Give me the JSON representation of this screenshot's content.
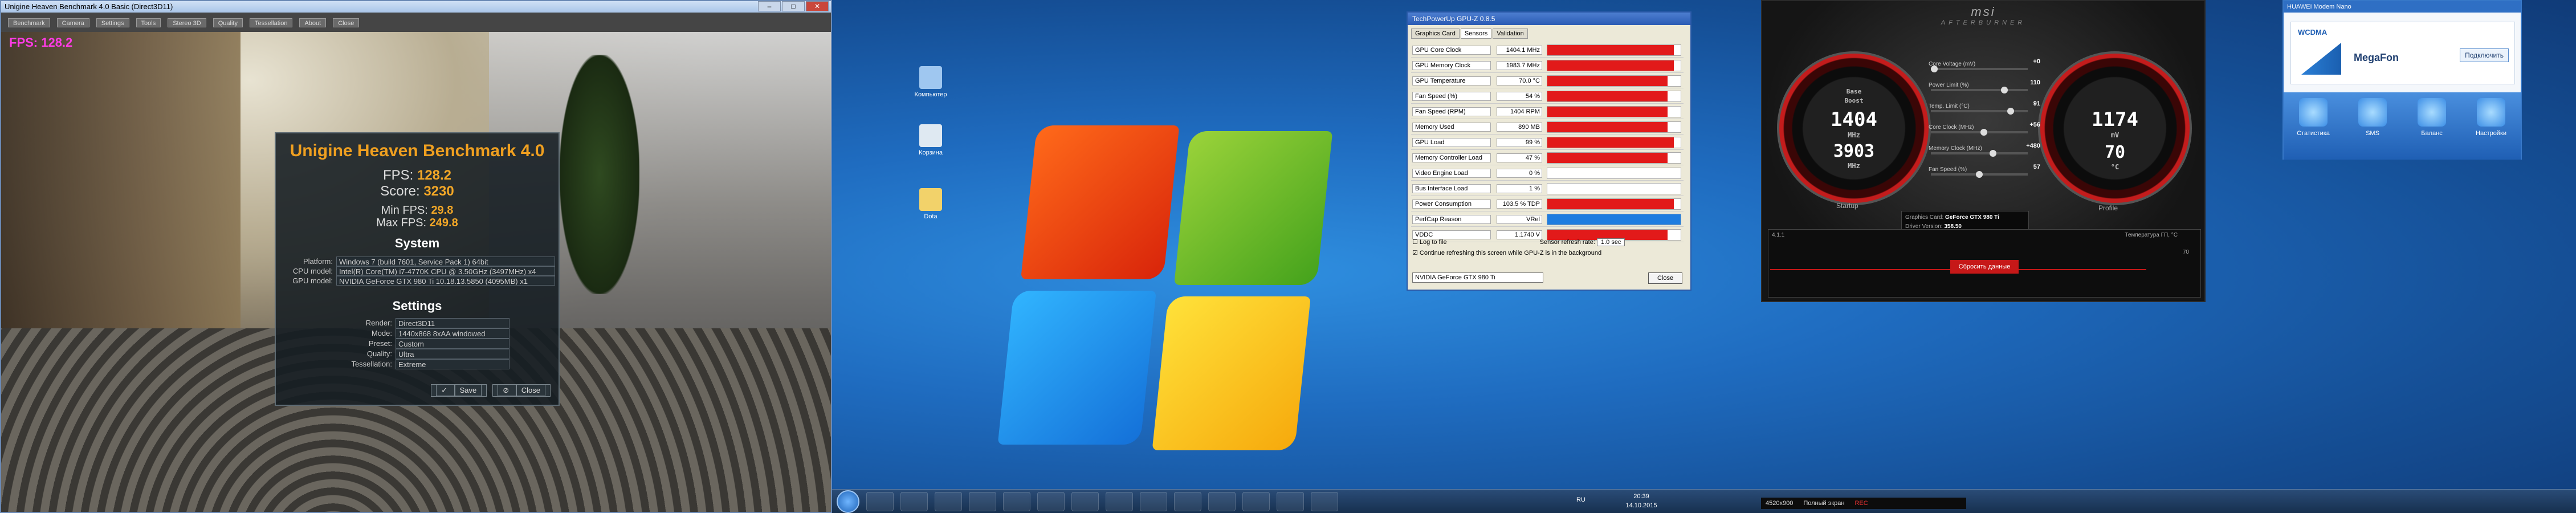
{
  "heaven": {
    "title": "Unigine Heaven Benchmark 4.0 Basic (Direct3D11)",
    "menu": [
      "Benchmark",
      "Camera",
      "Settings",
      "Tools",
      "Stereo 3D",
      "Quality",
      "Tessellation",
      "About",
      "Close"
    ],
    "overlay": "FPS: 128.2",
    "panel": {
      "title": "Unigine Heaven Benchmark 4.0",
      "fps_label": "FPS:",
      "fps": "128.2",
      "score_label": "Score:",
      "score": "3230",
      "min_label": "Min FPS:",
      "min": "29.8",
      "max_label": "Max FPS:",
      "max": "249.8",
      "system_heading": "System",
      "system": [
        {
          "k": "Platform:",
          "v": "Windows 7 (build 7601, Service Pack 1) 64bit"
        },
        {
          "k": "CPU model:",
          "v": "Intel(R) Core(TM) i7-4770K CPU @ 3.50GHz (3497MHz) x4"
        },
        {
          "k": "GPU model:",
          "v": "NVIDIA GeForce GTX 980 Ti 10.18.13.5850 (4095MB) x1"
        }
      ],
      "settings_heading": "Settings",
      "settings": [
        {
          "k": "Render:",
          "v": "Direct3D11"
        },
        {
          "k": "Mode:",
          "v": "1440x868 8xAA windowed"
        },
        {
          "k": "Preset:",
          "v": "Custom"
        },
        {
          "k": "Quality:",
          "v": "Ultra"
        },
        {
          "k": "Tessellation:",
          "v": "Extreme"
        }
      ],
      "save": "Save",
      "close": "Close"
    }
  },
  "desktop_icons": [
    {
      "label": "Компьютер",
      "color": "#9fc7f0"
    },
    {
      "label": "Корзина",
      "color": "#dfe9f2"
    },
    {
      "label": "Dota",
      "color": "#f2d26a"
    }
  ],
  "gpuz": {
    "title": "TechPowerUp GPU-Z 0.8.5",
    "tabs": [
      "Graphics Card",
      "Sensors",
      "Validation"
    ],
    "rows": [
      {
        "label": "GPU Core Clock",
        "value": "1404.1 MHz",
        "fill": 0.95,
        "color": "#e21a1a"
      },
      {
        "label": "GPU Memory Clock",
        "value": "1983.7 MHz",
        "fill": 0.95,
        "color": "#e21a1a"
      },
      {
        "label": "GPU Temperature",
        "value": "70.0 °C",
        "fill": 0.9,
        "color": "#e21a1a"
      },
      {
        "label": "Fan Speed (%)",
        "value": "54 %",
        "fill": 0.9,
        "color": "#e21a1a"
      },
      {
        "label": "Fan Speed (RPM)",
        "value": "1404 RPM",
        "fill": 0.9,
        "color": "#e21a1a"
      },
      {
        "label": "Memory Used",
        "value": "890 MB",
        "fill": 0.9,
        "color": "#e21a1a"
      },
      {
        "label": "GPU Load",
        "value": "99 %",
        "fill": 0.95,
        "color": "#e21a1a"
      },
      {
        "label": "Memory Controller Load",
        "value": "47 %",
        "fill": 0.9,
        "color": "#e21a1a"
      },
      {
        "label": "Video Engine Load",
        "value": "0 %",
        "fill": 0.0,
        "color": "#e21a1a"
      },
      {
        "label": "Bus Interface Load",
        "value": "1 %",
        "fill": 0.0,
        "color": "#e21a1a"
      },
      {
        "label": "Power Consumption",
        "value": "103.5 % TDP",
        "fill": 0.95,
        "color": "#e21a1a"
      },
      {
        "label": "PerfCap Reason",
        "value": "VRel",
        "fill": 1.0,
        "color": "#1e7de0"
      },
      {
        "label": "VDDC",
        "value": "1.1740 V",
        "fill": 0.9,
        "color": "#e21a1a"
      }
    ],
    "log": "Log to file",
    "continue": "Continue refreshing this screen while GPU-Z is in the background",
    "refresh_label": "Sensor refresh rate:",
    "refresh_value": "1.0 sec",
    "gpu": "NVIDIA GeForce GTX 980 Ti",
    "close": "Close"
  },
  "afterburner": {
    "brand": "msi",
    "sub": "AFTERBURNER",
    "gpu_clock_label": "Base",
    "gpu_clock_label2": "Boost",
    "gpu_clock": "1404",
    "gpu_clock_unit": "MHz",
    "mem_clock": "3903",
    "mem_clock_unit": "MHz",
    "voltage": "1174",
    "voltage_unit": "mV",
    "temp": "70",
    "temp_unit": "°C",
    "sliders": [
      {
        "label": "Core Voltage (mV)",
        "value": "+0",
        "pos": 0.0
      },
      {
        "label": "Power Limit (%)",
        "value": "110",
        "pos": 0.78
      },
      {
        "label": "Temp. Limit (°C)",
        "value": "91",
        "pos": 0.85
      },
      {
        "label": "Core Clock (MHz)",
        "value": "+56",
        "pos": 0.55
      },
      {
        "label": "Memory Clock (MHz)",
        "value": "+480",
        "pos": 0.65
      },
      {
        "label": "Fan Speed (%)",
        "value": "57",
        "pos": 0.5
      }
    ],
    "startup": "Startup",
    "profile": "Profile",
    "graphics_card_label": "Graphics Card:",
    "graphics_card": "GeForce GTX 980 Ti",
    "driver_label": "Driver Version:",
    "driver": "358.50",
    "version": "4.1.1",
    "graph_label": "Температура ГП, °C",
    "start_button": "Сбросить данные",
    "graph_val": "70"
  },
  "huawei": {
    "title": "HUAWEI Modem Nano",
    "network": "WCDMA",
    "operator": "MegaFon",
    "connect": "Подключить",
    "items": [
      "Статистика",
      "SMS",
      "Баланс",
      "Настройки"
    ]
  },
  "taskbar": {
    "lang": "RU",
    "time": "20:39",
    "date": "14.10.2015"
  },
  "recbar": {
    "res": "4520x900",
    "mode": "Полный экран",
    "rec": "REC"
  }
}
